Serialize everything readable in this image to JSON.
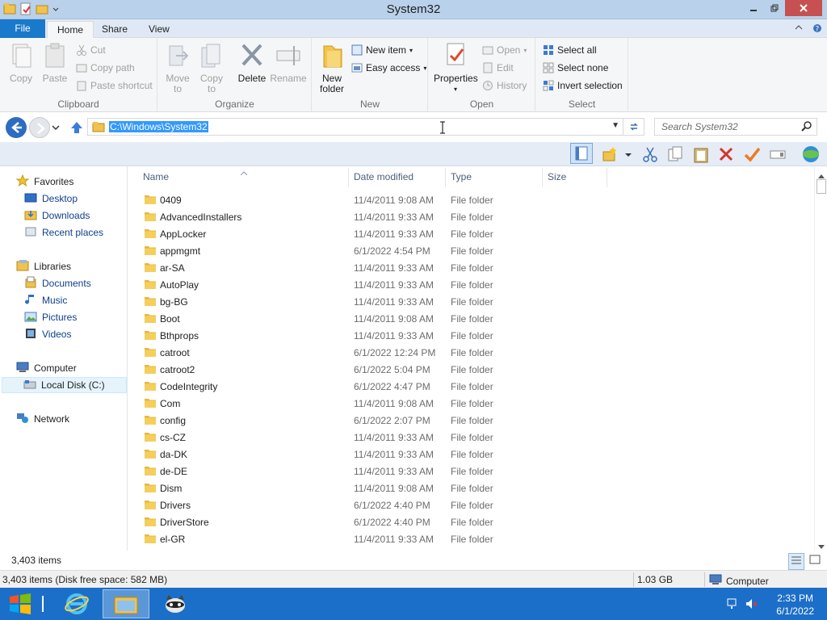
{
  "window": {
    "title": "System32"
  },
  "ribbon_tabs": {
    "file": "File",
    "home": "Home",
    "share": "Share",
    "view": "View"
  },
  "ribbon": {
    "clipboard": {
      "label": "Clipboard",
      "copy": "Copy",
      "paste": "Paste",
      "cut": "Cut",
      "copy_path": "Copy path",
      "paste_shortcut": "Paste shortcut"
    },
    "organize": {
      "label": "Organize",
      "move_to_1": "Move",
      "move_to_2": "to",
      "copy_to_1": "Copy",
      "copy_to_2": "to",
      "delete": "Delete",
      "rename": "Rename"
    },
    "new": {
      "label": "New",
      "new_folder_1": "New",
      "new_folder_2": "folder",
      "new_item": "New item",
      "easy_access": "Easy access"
    },
    "open": {
      "label": "Open",
      "properties": "Properties",
      "open": "Open",
      "edit": "Edit",
      "history": "History"
    },
    "select": {
      "label": "Select",
      "select_all": "Select all",
      "select_none": "Select none",
      "invert_selection": "Invert selection"
    }
  },
  "address": {
    "path": "C:\\Windows\\System32",
    "search_placeholder": "Search System32"
  },
  "nav": {
    "favorites": "Favorites",
    "desktop": "Desktop",
    "downloads": "Downloads",
    "recent_places": "Recent places",
    "libraries": "Libraries",
    "documents": "Documents",
    "music": "Music",
    "pictures": "Pictures",
    "videos": "Videos",
    "computer": "Computer",
    "local_disk": "Local Disk (C:)",
    "network": "Network"
  },
  "columns": {
    "name": "Name",
    "date_modified": "Date modified",
    "type": "Type",
    "size": "Size"
  },
  "files": [
    {
      "name": "0409",
      "date": "11/4/2011 9:08 AM",
      "type": "File folder"
    },
    {
      "name": "AdvancedInstallers",
      "date": "11/4/2011 9:33 AM",
      "type": "File folder"
    },
    {
      "name": "AppLocker",
      "date": "11/4/2011 9:33 AM",
      "type": "File folder"
    },
    {
      "name": "appmgmt",
      "date": "6/1/2022 4:54 PM",
      "type": "File folder"
    },
    {
      "name": "ar-SA",
      "date": "11/4/2011 9:33 AM",
      "type": "File folder"
    },
    {
      "name": "AutoPlay",
      "date": "11/4/2011 9:33 AM",
      "type": "File folder"
    },
    {
      "name": "bg-BG",
      "date": "11/4/2011 9:33 AM",
      "type": "File folder"
    },
    {
      "name": "Boot",
      "date": "11/4/2011 9:08 AM",
      "type": "File folder"
    },
    {
      "name": "Bthprops",
      "date": "11/4/2011 9:33 AM",
      "type": "File folder"
    },
    {
      "name": "catroot",
      "date": "6/1/2022 12:24 PM",
      "type": "File folder"
    },
    {
      "name": "catroot2",
      "date": "6/1/2022 5:04 PM",
      "type": "File folder"
    },
    {
      "name": "CodeIntegrity",
      "date": "6/1/2022 4:47 PM",
      "type": "File folder"
    },
    {
      "name": "Com",
      "date": "11/4/2011 9:08 AM",
      "type": "File folder"
    },
    {
      "name": "config",
      "date": "6/1/2022 2:07 PM",
      "type": "File folder"
    },
    {
      "name": "cs-CZ",
      "date": "11/4/2011 9:33 AM",
      "type": "File folder"
    },
    {
      "name": "da-DK",
      "date": "11/4/2011 9:33 AM",
      "type": "File folder"
    },
    {
      "name": "de-DE",
      "date": "11/4/2011 9:33 AM",
      "type": "File folder"
    },
    {
      "name": "Dism",
      "date": "11/4/2011 9:08 AM",
      "type": "File folder"
    },
    {
      "name": "Drivers",
      "date": "6/1/2022 4:40 PM",
      "type": "File folder"
    },
    {
      "name": "DriverStore",
      "date": "6/1/2022 4:40 PM",
      "type": "File folder"
    },
    {
      "name": "el-GR",
      "date": "11/4/2011 9:33 AM",
      "type": "File folder"
    }
  ],
  "status": {
    "item_count": "3,403 items"
  },
  "details": {
    "summary": "3,403 items (Disk free space: 582 MB)",
    "size": "1.03 GB",
    "location": "Computer"
  },
  "taskbar": {
    "time": "2:33 PM",
    "date": "6/1/2022"
  },
  "colors": {
    "accent": "#1979ca",
    "taskbar": "#1c6fc8",
    "titlebar": "#b9d1ea",
    "close": "#c75050"
  }
}
